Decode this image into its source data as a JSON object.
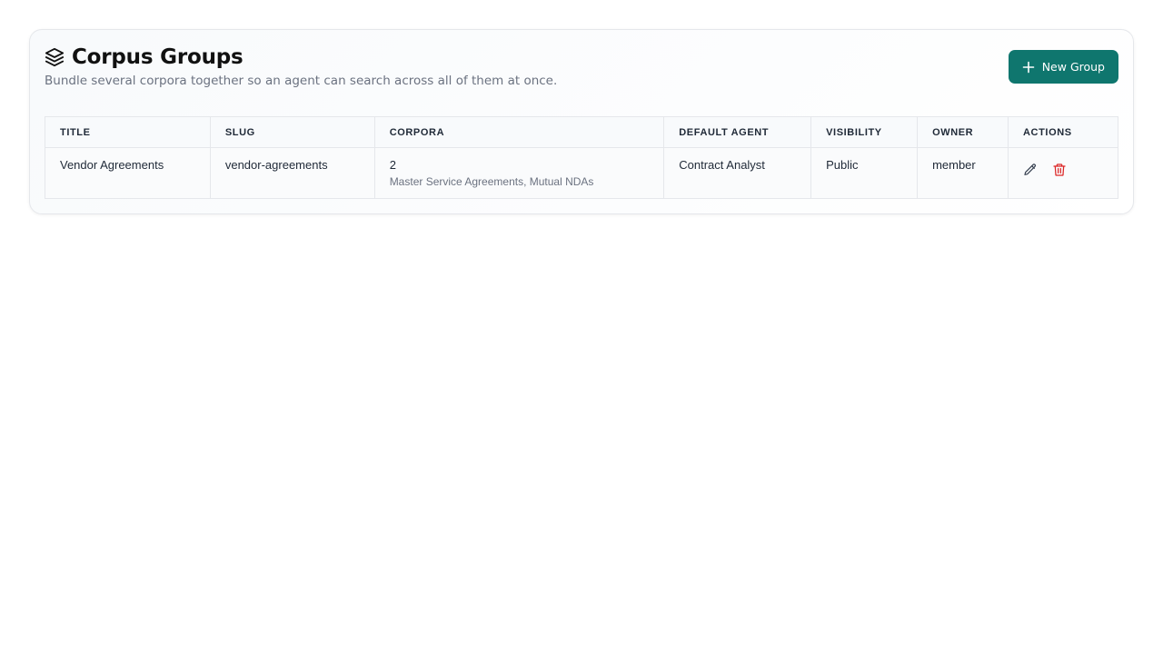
{
  "header": {
    "title": "Corpus Groups",
    "subtitle": "Bundle several corpora together so an agent can search across all of them at once.",
    "new_button_label": "New Group",
    "title_icon": "layers-icon",
    "new_button_icon": "plus-icon"
  },
  "table": {
    "columns": [
      "TITLE",
      "SLUG",
      "CORPORA",
      "DEFAULT AGENT",
      "VISIBILITY",
      "OWNER",
      "ACTIONS"
    ],
    "rows": [
      {
        "title": "Vendor Agreements",
        "slug": "vendor-agreements",
        "corpora_count": "2",
        "corpora_names": "Master Service Agreements, Mutual NDAs",
        "default_agent": "Contract Analyst",
        "visibility": "Public",
        "owner": "member",
        "actions": [
          "edit-icon",
          "delete-icon"
        ]
      }
    ]
  },
  "colors": {
    "accent": "#0f766e",
    "danger": "#dc2626",
    "muted_text": "#6b7280",
    "border": "#e5e7eb"
  }
}
